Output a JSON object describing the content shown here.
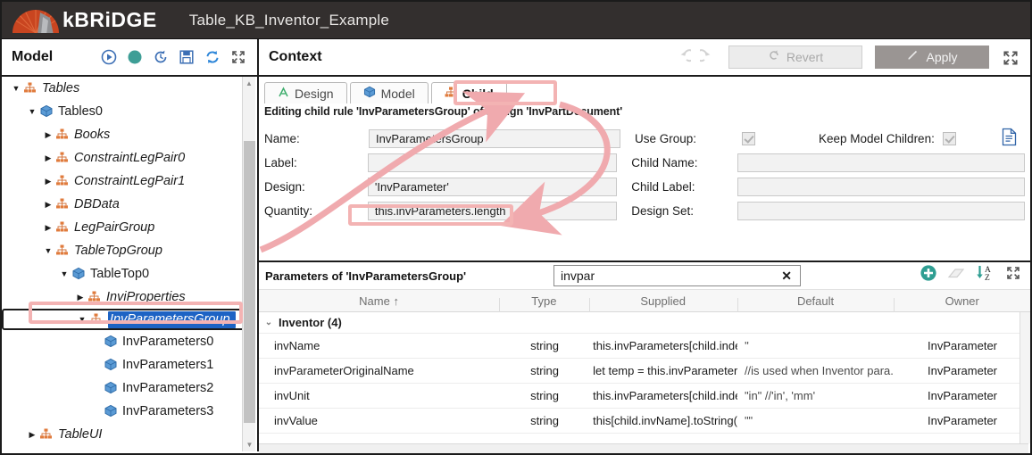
{
  "titlebar": {
    "brand": "kBRiDGE",
    "document_title": "Table_KB_Inventor_Example",
    "logo_icon": "kbridge-arch-logo"
  },
  "model_panel": {
    "title": "Model",
    "toolbar_icons": [
      "play-icon",
      "record-icon",
      "history-icon",
      "save-icon",
      "refresh-icon",
      "expand-icon"
    ],
    "tree": [
      {
        "label": "Tables",
        "indent": 0,
        "twist": "down",
        "icon": "hierarchy-icon",
        "italic": true,
        "selected": false
      },
      {
        "label": "Tables0",
        "indent": 1,
        "twist": "down",
        "icon": "cube-icon",
        "italic": false,
        "selected": false
      },
      {
        "label": "Books",
        "indent": 2,
        "twist": "right",
        "icon": "hierarchy-icon",
        "italic": true,
        "selected": false
      },
      {
        "label": "ConstraintLegPair0",
        "indent": 2,
        "twist": "right",
        "icon": "hierarchy-icon",
        "italic": true,
        "selected": false
      },
      {
        "label": "ConstraintLegPair1",
        "indent": 2,
        "twist": "right",
        "icon": "hierarchy-icon",
        "italic": true,
        "selected": false
      },
      {
        "label": "DBData",
        "indent": 2,
        "twist": "right",
        "icon": "hierarchy-icon",
        "italic": true,
        "selected": false
      },
      {
        "label": "LegPairGroup",
        "indent": 2,
        "twist": "right",
        "icon": "hierarchy-icon",
        "italic": true,
        "selected": false
      },
      {
        "label": "TableTopGroup",
        "indent": 2,
        "twist": "down",
        "icon": "hierarchy-icon",
        "italic": true,
        "selected": false
      },
      {
        "label": "TableTop0",
        "indent": 3,
        "twist": "down",
        "icon": "cube-icon",
        "italic": false,
        "selected": false
      },
      {
        "label": "InviProperties",
        "indent": 4,
        "twist": "right",
        "icon": "hierarchy-icon",
        "italic": true,
        "selected": false
      },
      {
        "label": "InvParametersGroup",
        "indent": 4,
        "twist": "down",
        "icon": "hierarchy-icon",
        "italic": true,
        "selected": true
      },
      {
        "label": "InvParameters0",
        "indent": 5,
        "twist": "none",
        "icon": "cube-icon",
        "italic": false,
        "selected": false
      },
      {
        "label": "InvParameters1",
        "indent": 5,
        "twist": "none",
        "icon": "cube-icon",
        "italic": false,
        "selected": false
      },
      {
        "label": "InvParameters2",
        "indent": 5,
        "twist": "none",
        "icon": "cube-icon",
        "italic": false,
        "selected": false
      },
      {
        "label": "InvParameters3",
        "indent": 5,
        "twist": "none",
        "icon": "cube-icon",
        "italic": false,
        "selected": false
      },
      {
        "label": "TableUI",
        "indent": 1,
        "twist": "right",
        "icon": "hierarchy-icon",
        "italic": true,
        "selected": false
      }
    ]
  },
  "context_panel": {
    "title": "Context",
    "undo_label": "undo-icon",
    "redo_label": "redo-icon",
    "revert_label": "Revert",
    "apply_label": "Apply",
    "expand_icon": "expand-icon",
    "tabs": [
      {
        "label": "Design",
        "icon": "design-a-icon",
        "active": false
      },
      {
        "label": "Model",
        "icon": "cube-icon",
        "active": false
      },
      {
        "label": "Child",
        "icon": "hierarchy-icon",
        "active": true
      }
    ],
    "editing_line": "Editing child rule 'InvParametersGroup' of Design 'InvPartDocument'",
    "fields_left": [
      {
        "label": "Name:",
        "value": "InvParametersGroup"
      },
      {
        "label": "Label:",
        "value": ""
      },
      {
        "label": "Design:",
        "value": "'InvParameter'"
      },
      {
        "label": "Quantity:",
        "value": "this.invParameters.length"
      }
    ],
    "use_group": {
      "label": "Use Group:",
      "checked": true
    },
    "keep_model_children": {
      "label": "Keep Model Children:",
      "checked": true
    },
    "doc_icon": "document-icon",
    "fields_right": [
      {
        "label": "Child Name:",
        "value": ""
      },
      {
        "label": "Child Label:",
        "value": ""
      },
      {
        "label": "Design Set:",
        "value": ""
      }
    ]
  },
  "parameters_panel": {
    "title": "Parameters of 'InvParametersGroup'",
    "search": {
      "value": "invpar",
      "placeholder": "",
      "clear_icon": "clear-x-icon"
    },
    "icons": [
      "add-circle-icon",
      "eraser-icon",
      "sort-az-icon",
      "expand-icon"
    ],
    "columns": [
      {
        "label": "Name",
        "sort": "↑"
      },
      {
        "label": "Type",
        "sort": ""
      },
      {
        "label": "Supplied",
        "sort": ""
      },
      {
        "label": "Default",
        "sort": ""
      },
      {
        "label": "Owner",
        "sort": ""
      }
    ],
    "group": {
      "label": "Inventor (4)",
      "caret": "down"
    },
    "rows": [
      {
        "name": "invName",
        "type": "string",
        "supplied": "this.invParameters[child.index...",
        "default": "''",
        "owner": "InvParameter"
      },
      {
        "name": "invParameterOriginalName",
        "type": "string",
        "supplied": "let temp = this.invParameters...",
        "default": "//is used when Inventor para...",
        "owner": "InvParameter"
      },
      {
        "name": "invUnit",
        "type": "string",
        "supplied": "this.invParameters[child.index...",
        "default": "\"in\" //'in', 'mm'",
        "owner": "InvParameter"
      },
      {
        "name": "invValue",
        "type": "string",
        "supplied": "this[child.invName].toString()",
        "default": "\"\"",
        "owner": "InvParameter"
      }
    ]
  },
  "annotations": {
    "highlight_color": "#f3b3b3",
    "arrow_color": "#f0aaae",
    "highlights": [
      "tree-selected-node",
      "child-tab",
      "quantity-field"
    ],
    "arrows": [
      "tree-node-to-child-tab",
      "child-tab-to-quantity-field"
    ]
  }
}
